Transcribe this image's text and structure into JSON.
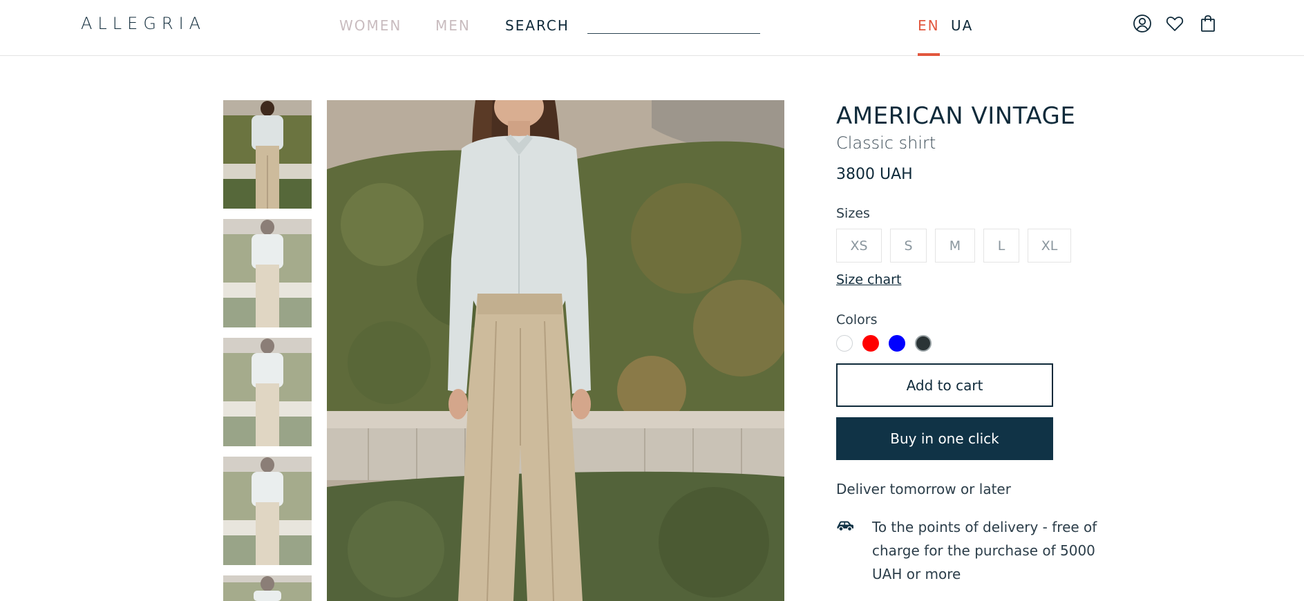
{
  "header": {
    "logo": "ALLEGRIA",
    "nav": {
      "women": "WOMEN",
      "men": "MEN",
      "search": "SEARCH"
    },
    "search_value": "",
    "languages": {
      "en": "EN",
      "ua": "UA",
      "active": "EN"
    },
    "icons": [
      "user-icon",
      "heart-icon",
      "shopping-bag-icon"
    ]
  },
  "gallery": {
    "thumbnail_count_visible": 5,
    "active_index": 0
  },
  "product": {
    "brand": "AMERICAN VINTAGE",
    "name": "Classic shirt",
    "price": "3800 UAH",
    "sizes_label": "Sizes",
    "sizes": [
      "XS",
      "S",
      "M",
      "L",
      "XL"
    ],
    "size_chart_label": "Size chart",
    "colors_label": "Colors",
    "colors": [
      "#ffffff",
      "#ff0000",
      "#0000ff",
      "#2b3436"
    ],
    "add_to_cart_label": "Add to cart",
    "buy_one_click_label": "Buy in one click",
    "delivery_heading": "Deliver tomorrow or later",
    "delivery_option": "To the points of delivery - free of charge for the purchase of 5000 UAH or more",
    "delivery_icon": "car-icon"
  },
  "colors": {
    "accent": "#e2573e",
    "primary": "#103346",
    "nav_inactive": "#c9bcbf"
  }
}
